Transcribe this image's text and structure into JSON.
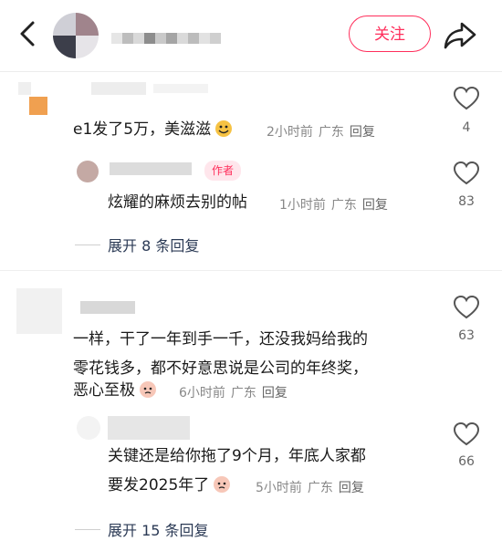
{
  "header": {
    "follow_label": "关注",
    "accent": "#ff2e5b"
  },
  "comments": [
    {
      "text": "e1发了5万，美滋滋",
      "time": "2小时前",
      "region": "广东",
      "reply": "回复",
      "likes": "4",
      "emoji": "face-emoji",
      "replies": [
        {
          "badge": "作者",
          "text": "炫耀的麻烦去别的帖",
          "time": "1小时前",
          "region": "广东",
          "reply": "回复",
          "likes": "83"
        }
      ],
      "expand": "展开 8 条回复"
    },
    {
      "lines": [
        "一样，干了一年到手一千，还没我妈给我的",
        "零花钱多，都不好意思说是公司的年终奖，",
        "恶心至极"
      ],
      "time": "6小时前",
      "region": "广东",
      "reply": "回复",
      "likes": "63",
      "emoji": "face-emoji",
      "replies": [
        {
          "lines": [
            "关键还是给你拖了9个月，年底人家都",
            "要发2025年了"
          ],
          "time": "5小时前",
          "region": "广东",
          "reply": "回复",
          "likes": "66",
          "emoji": "face-emoji"
        }
      ],
      "expand": "展开 15 条回复"
    }
  ]
}
